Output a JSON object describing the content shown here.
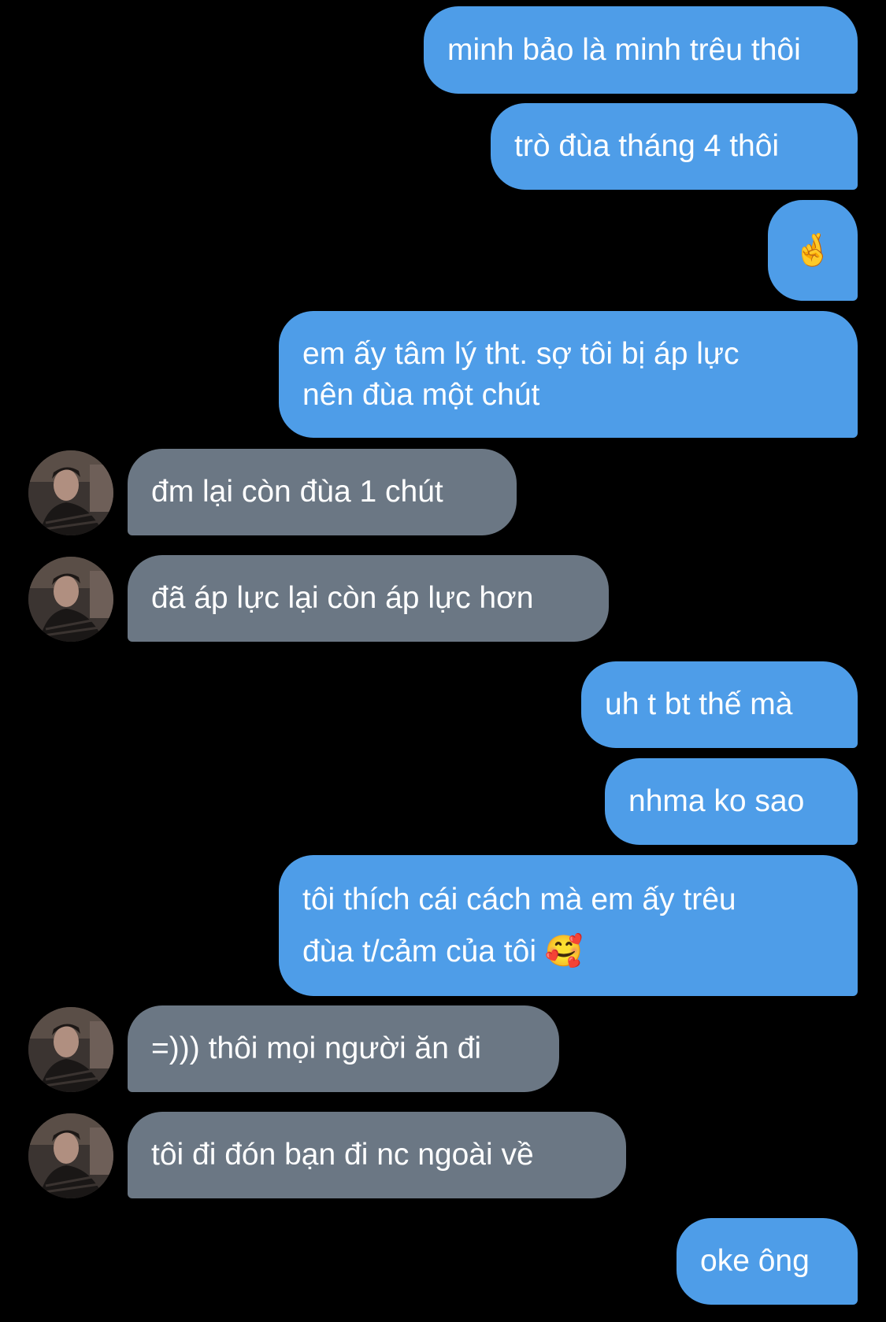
{
  "colors": {
    "background": "#000000",
    "outgoing_bubble": "#4e9de8",
    "incoming_bubble": "#6b7784",
    "text": "#ffffff"
  },
  "messages": [
    {
      "direction": "outgoing",
      "text": "minh bảo là minh trêu thôi"
    },
    {
      "direction": "outgoing",
      "text": "trò đùa tháng 4 thôi"
    },
    {
      "direction": "outgoing",
      "text": "🤞"
    },
    {
      "direction": "outgoing",
      "lines": [
        "em ấy tâm lý tht. sợ tôi bị áp lực",
        "nên đùa một chút"
      ]
    },
    {
      "direction": "incoming",
      "text": "đm lại còn đùa 1 chút"
    },
    {
      "direction": "incoming",
      "text": "đã áp lực lại còn áp lực hơn"
    },
    {
      "direction": "outgoing",
      "text": "uh t bt thế mà"
    },
    {
      "direction": "outgoing",
      "text": "nhma ko sao"
    },
    {
      "direction": "outgoing",
      "lines": [
        "tôi thích cái cách mà em ấy trêu",
        "đùa t/cảm của tôi 🥰"
      ]
    },
    {
      "direction": "incoming",
      "text": "=))) thôi mọi người ăn đi"
    },
    {
      "direction": "incoming",
      "text": "tôi đi đón bạn đi nc ngoài về"
    },
    {
      "direction": "outgoing",
      "text": "oke ông"
    }
  ],
  "avatar_icon": "contact-avatar-photo"
}
